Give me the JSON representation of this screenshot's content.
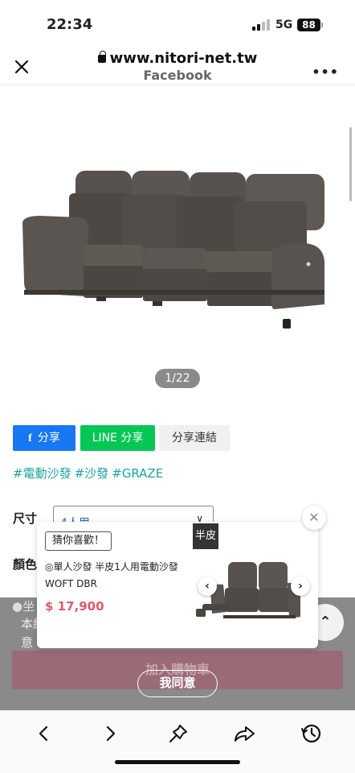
{
  "status_bar": {
    "time": "22:34",
    "network": "5G",
    "battery": "88"
  },
  "browser": {
    "url": "www.nitori-net.tw",
    "site_name": "Facebook",
    "more_label": "•••"
  },
  "product": {
    "image_icon": "sofa-image",
    "pager": "1/22"
  },
  "share": {
    "facebook_icon": "f",
    "facebook": "分享",
    "line": "LINE 分享",
    "link": "分享連結"
  },
  "tags": [
    "#電動沙發",
    "#沙發",
    "#GRAZE"
  ],
  "options": {
    "size_label": "尺寸",
    "size_value": "4人用",
    "color_label": "顏色"
  },
  "recommend": {
    "badge": "猜你喜歡！",
    "title": "◎單人沙發 半皮1人用電動沙發 WOFT DBR",
    "price": "$ 17,900",
    "tag": "半皮",
    "close": "✕"
  },
  "consent": {
    "line1": "●坐",
    "line2": "本網",
    "line3": "意",
    "cart_label": "加入購物車",
    "agree": "我同意"
  },
  "toolbar": {
    "icons": [
      "back-icon",
      "forward-icon",
      "pin-icon",
      "share-icon",
      "history-icon"
    ]
  },
  "colors": {
    "facebook": "#1877f2",
    "line": "#06c755",
    "tag_text": "#1ba39c",
    "price": "#e05a6a"
  }
}
